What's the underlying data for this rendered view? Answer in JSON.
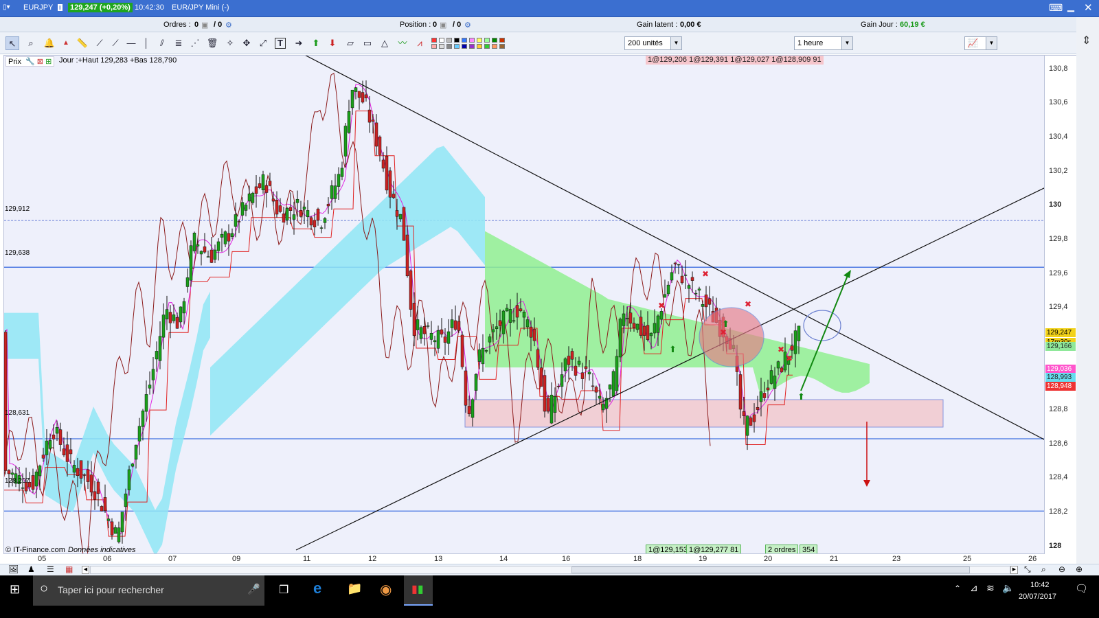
{
  "window": {
    "symbol": "EURJPY",
    "price_badge": "129,247 (+0,20%)",
    "time": "10:42:30",
    "title": "EUR/JPY Mini (-)"
  },
  "infobar": {
    "orders_label": "Ordres :",
    "orders_value": "0",
    "orders_value2": "/ 0",
    "position_label": "Position :",
    "position_value": "0",
    "position_value2": "/ 0",
    "gain_latent_label": "Gain latent :",
    "gain_latent_value": "0,00 €",
    "gain_jour_label": "Gain Jour :",
    "gain_jour_value": "60,19 €"
  },
  "toolbar": {
    "quantity_select": "200 unités",
    "period_select": "1 heure"
  },
  "chart": {
    "price_label": "Prix",
    "day_info": "Jour :+Haut 129,283 +Bas 128,790",
    "orders_top": "1@129,206 1@129,391 1@129,027 1@128,909 91",
    "orders_bottom_1": "1@129,153",
    "orders_bottom_2": "1@129,277 81",
    "orders_bottom_3": "2 ordres",
    "orders_bottom_3b": "354",
    "copyright": "© IT-Finance.com",
    "disclaimer": "Données indicatives",
    "level_labels": [
      "129,912",
      "129,638",
      "128,631",
      "128,207"
    ]
  },
  "chart_data": {
    "type": "candlestick",
    "ylim": [
      127.95,
      130.88
    ],
    "y_ticks": [
      "130,8",
      "130,6",
      "130,4",
      "130,2",
      "130",
      "129,8",
      "129,6",
      "129,4",
      "129,2",
      "129",
      "128,8",
      "128,6",
      "128,4",
      "128,2",
      "128"
    ],
    "x_ticks": [
      "05",
      "06",
      "07",
      "09",
      "11",
      "12",
      "13",
      "14",
      "16",
      "18",
      "19",
      "20",
      "21",
      "23",
      "25",
      "26"
    ],
    "horizontal_levels": [
      129.912,
      129.638,
      128.631,
      128.207
    ],
    "current_price": "129,247",
    "countdown": "17m30s",
    "side_tags": [
      {
        "text": "129,166",
        "color": "#8fe89a"
      },
      {
        "text": "129,036",
        "color": "#ff55cc"
      },
      {
        "text": "128,993",
        "color": "#66ddee"
      },
      {
        "text": "128,948",
        "color": "#ee3333"
      }
    ],
    "colors": {
      "up": "#1aa01a",
      "down": "#cc2222",
      "kumo_bull": "#90f090",
      "kumo_bear": "#8fe6f5",
      "kijun": "#e02020",
      "tenkan": "#e020e0",
      "chikou": "#8b1a1a"
    }
  },
  "taskbar": {
    "search_placeholder": "Taper ici pour rechercher",
    "clock_time": "10:42",
    "clock_date": "20/07/2017"
  }
}
